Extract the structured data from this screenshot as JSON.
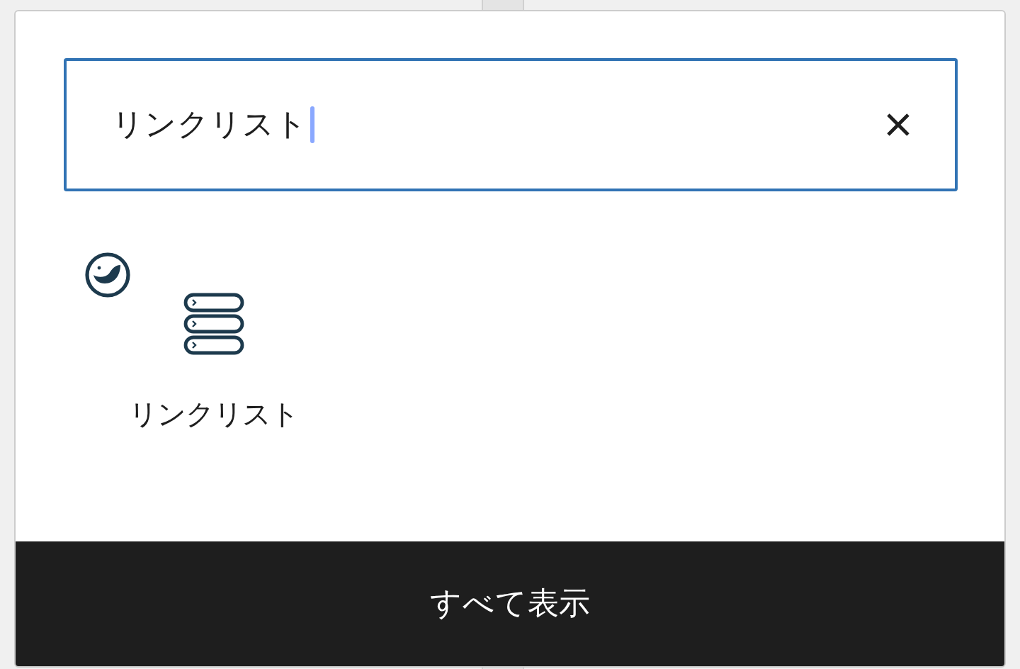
{
  "search": {
    "value": "リンクリスト"
  },
  "results": [
    {
      "label": "リンクリスト"
    }
  ],
  "footer_button": "すべて表示"
}
